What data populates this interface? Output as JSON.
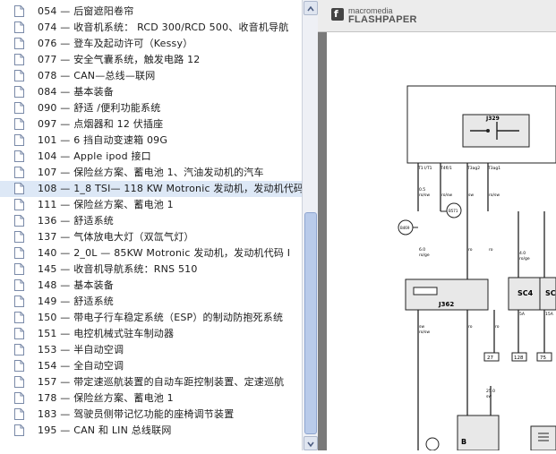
{
  "doc_list": {
    "items": [
      {
        "label": "054 — 后窗遮阳卷帘"
      },
      {
        "label": "074 — 收音机系统： RCD 300/RCD 500、收音机导航"
      },
      {
        "label": "076 — 登车及起动许可（Kessy）"
      },
      {
        "label": "077 — 安全气囊系统，触发电路 12"
      },
      {
        "label": "078 — CAN—总线—联网"
      },
      {
        "label": "084 — 基本装备"
      },
      {
        "label": "090 — 舒适 /便利功能系统"
      },
      {
        "label": "097 — 点烟器和 12 伏插座"
      },
      {
        "label": "101 — 6 挡自动变速箱 09G"
      },
      {
        "label": "104 — Apple ipod 接口"
      },
      {
        "label": "107 — 保险丝方案、蓄电池 1、汽油发动机的汽车"
      },
      {
        "label": "108 — 1_8 TSI— 118 KW Motronic 发动机，发动机代码"
      },
      {
        "label": "111 — 保险丝方案、蓄电池 1"
      },
      {
        "label": "136 — 舒适系统"
      },
      {
        "label": "137 — 气体放电大灯（双氙气灯）"
      },
      {
        "label": "140 — 2_0L — 85KW Motronic 发动机，发动机代码 I"
      },
      {
        "label": "145 — 收音机导航系统：RNS 510"
      },
      {
        "label": "148 — 基本装备"
      },
      {
        "label": "149 — 舒适系统"
      },
      {
        "label": "150 — 带电子行车稳定系统（ESP）的制动防抱死系统"
      },
      {
        "label": "151 — 电控机械式驻车制动器"
      },
      {
        "label": "153 — 半自动空调"
      },
      {
        "label": "154 — 全自动空调"
      },
      {
        "label": "157 — 带定速巡航装置的自动车距控制装置、定速巡航"
      },
      {
        "label": "178 — 保险丝方案、蓄电池 1"
      },
      {
        "label": "183 — 驾驶员侧带记忆功能的座椅调节装置"
      },
      {
        "label": "195 — CAN 和 LIN 总线联网"
      }
    ],
    "selected_index": 11
  },
  "viewer": {
    "brand_top": "macromedia",
    "brand_bottom": "FLASHPAPER",
    "logo_glyph": "f"
  },
  "diagram": {
    "component_labels": [
      "J329",
      "J362",
      "SC4",
      "SC"
    ],
    "wire_labels": [
      "T1 I/T1",
      "T4fl/1",
      "T3ag2",
      "T3ag1",
      "0.5",
      "ro/sw",
      "ro/sw",
      "sw",
      "ro/sw",
      "6.0",
      "ro/ge",
      "ro",
      "ro",
      "4.0",
      "ro/ge",
      "sw",
      "ro",
      "4.0",
      "ro/ge",
      "5A",
      "15A",
      "sw",
      "ro/sw",
      "ro",
      "ro",
      "sc21",
      "sc",
      "27",
      "128",
      "75",
      "25.0",
      "sw",
      "B"
    ],
    "connector_labels": [
      "B469",
      "B571",
      "B65",
      "B67",
      "A69"
    ]
  },
  "colors": {
    "selected_row": "#dde8f6",
    "scrollbar_thumb": "#b9cbea",
    "viewer_bg": "#7a7a7a"
  }
}
